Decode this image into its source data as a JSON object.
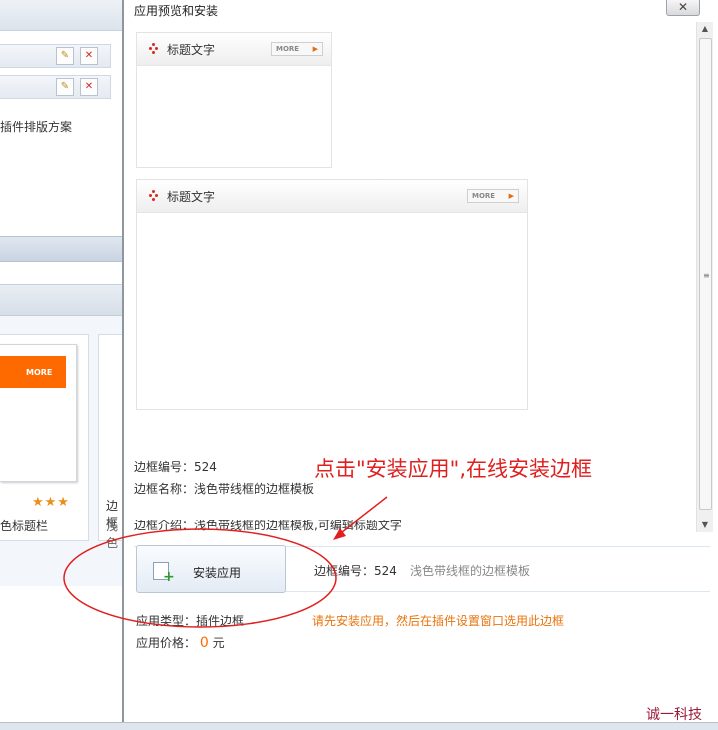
{
  "background_page": {
    "description_fragment": "插件排版方案",
    "card_more_label": "MORE",
    "card_stars": "★★★",
    "card_caption": "色标题栏",
    "card2_title": "边框",
    "card2_line": "浅色"
  },
  "dialog": {
    "title": "应用预览和安装",
    "close_glyph": "✕",
    "preview_frames": [
      {
        "title": "标题文字",
        "more": "MORE"
      },
      {
        "title": "标题文字",
        "more": "MORE"
      }
    ],
    "frame_id_line": "边框编号：524",
    "frame_name_line": "边框名称：浅色带线框的边框模板",
    "frame_intro_line": "边框介绍：浅色带线框的边框模板,可编辑标题文字",
    "install_button": "安装应用",
    "install_id_label": "边框编号：524",
    "install_template_name": "浅色带线框的边框模板",
    "app_type": "应用类型：插件边框",
    "price_label": "应用价格：",
    "price_value": "0",
    "price_unit": "元",
    "notice": "请先安装应用，然后在插件设置窗口选用此边框"
  },
  "annotation": {
    "text": "点击\"安装应用\",在线安装边框",
    "color": "#e02020"
  },
  "watermark": "诚一科技",
  "colors": {
    "accent_orange": "#ff6a00",
    "notice_orange": "#e8740c",
    "annotation_red": "#e02020"
  }
}
